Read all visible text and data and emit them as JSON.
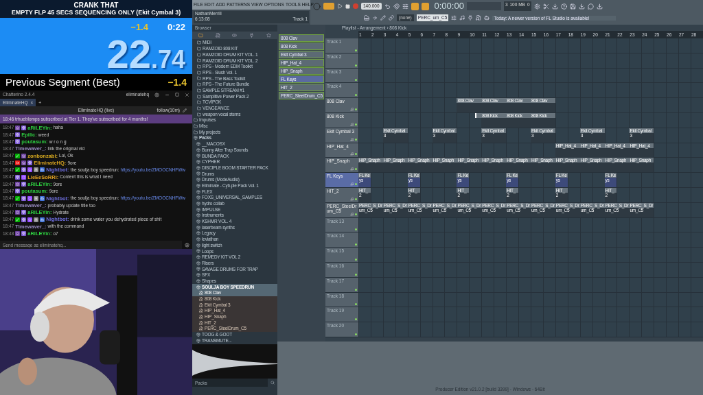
{
  "timer": {
    "game": "CRANK THAT",
    "category": "EMPTY FLP 45 SECS SEQUENCING ONLY (Ekit Cymbal 3)",
    "delta": "−1.4",
    "segment_time": "0:22",
    "main_whole": "22",
    "main_fraction": ".74",
    "previous_label": "Previous Segment (Best)",
    "previous_value": "−1.4"
  },
  "chat": {
    "app": "Chatterino 2.4.4",
    "account": "eliminatehq",
    "tab": "EliminateHQ",
    "tab_close": "×",
    "add_tab": "+",
    "channel": "EliminateHQ (live)",
    "follow": "follow(10m)",
    "notice": "18:46 trhueblomps subscribed at Tier 1. They've subscribed for 4 months!",
    "messages": [
      {
        "time": "18:47",
        "badges": [
          {
            "kind": "crown"
          },
          {
            "kind": "sub"
          }
        ],
        "user": "aRiLEYin:",
        "color": "#2ecc40",
        "text": "haha"
      },
      {
        "time": "18:47",
        "badges": [
          {
            "kind": "sub"
          }
        ],
        "user": "Epilic:",
        "color": "#2ecc40",
        "text": "weed"
      },
      {
        "time": "18:47",
        "badges": [
          {
            "kind": "sub"
          }
        ],
        "user": "poutasum:",
        "color": "#2ecc40",
        "text": "w r o n g"
      },
      {
        "time": "18:47",
        "user": "Timewaver_:",
        "color": "#9b8ec4",
        "text": "link the original vid"
      },
      {
        "time": "18:47",
        "badges": [
          {
            "kind": "mod"
          },
          {
            "kind": "crown"
          }
        ],
        "user": "zonbonzabi:",
        "color": "#e0b020",
        "text": "Lol, Ok"
      },
      {
        "time": "18:47",
        "badges": [
          {
            "kind": "broadcaster"
          },
          {
            "kind": "crown"
          },
          {
            "kind": "sub"
          }
        ],
        "user": "EliminateHQ:",
        "color": "#d4a020",
        "text": "9ore"
      },
      {
        "time": "18:47",
        "badges": [
          {
            "kind": "mod"
          },
          {
            "kind": "sub"
          },
          {
            "kind": "star"
          },
          {
            "kind": "gear"
          },
          {
            "kind": "bot"
          }
        ],
        "user": "Nightbot:",
        "color": "#6f6fe0",
        "text": "the soulja boy speedrun:",
        "link": "https://youtu.be/ZMOOCNHFWw"
      },
      {
        "time": "18:47",
        "badges": [
          {
            "kind": "sub"
          },
          {
            "kind": "star"
          }
        ],
        "user": "LieEeSoRRi:",
        "color": "#e0a020",
        "text": "Content this is what I need"
      },
      {
        "time": "18:47",
        "badges": [
          {
            "kind": "crown"
          },
          {
            "kind": "sub"
          }
        ],
        "user": "aRiLEYin:",
        "color": "#2ecc40",
        "text": "9ore"
      },
      {
        "time": "18:47",
        "badges": [
          {
            "kind": "sub"
          }
        ],
        "user": "poutasum:",
        "color": "#2ecc40",
        "text": "9ore"
      },
      {
        "time": "18:47",
        "badges": [
          {
            "kind": "mod"
          },
          {
            "kind": "sub"
          },
          {
            "kind": "star"
          },
          {
            "kind": "gear"
          },
          {
            "kind": "bot"
          }
        ],
        "user": "Nightbot:",
        "color": "#6f6fe0",
        "text": "the soulja boy speedrun:",
        "link": "https://youtu.be/ZMOOCNHFWw"
      },
      {
        "time": "18:47",
        "user": "Timewaver_:",
        "color": "#9b8ec4",
        "text": "probably update title too"
      },
      {
        "time": "18:47",
        "badges": [
          {
            "kind": "crown"
          },
          {
            "kind": "sub"
          }
        ],
        "user": "aRiLEYin:",
        "color": "#2ecc40",
        "text": "Hydrate"
      },
      {
        "time": "18:47",
        "badges": [
          {
            "kind": "mod"
          },
          {
            "kind": "sub"
          },
          {
            "kind": "star"
          },
          {
            "kind": "gear"
          },
          {
            "kind": "bot"
          }
        ],
        "user": "Nightbot:",
        "color": "#6f6fe0",
        "text": "drink some water you dehydrated piece of shit"
      },
      {
        "time": "18:47",
        "user": "Timewaver_:",
        "color": "#9b8ec4",
        "text": "with the command"
      },
      {
        "time": "18:48",
        "badges": [
          {
            "kind": "crown"
          },
          {
            "kind": "sub"
          }
        ],
        "user": "aRiLEYin:",
        "color": "#2ecc40",
        "text": "o7"
      }
    ],
    "input_placeholder": "Send message as eliminatehq..."
  },
  "menu": [
    "FILE",
    "EDIT",
    "ADD",
    "PATTERNS",
    "VIEW",
    "OPTIONS",
    "TOOLS",
    "HELP"
  ],
  "hint": {
    "user": "NathanMerrill",
    "time": "6:13:08",
    "track": "Track 1"
  },
  "transport": {
    "song_mode": true,
    "tempo": "140.000",
    "time": "0:00:00",
    "cpu": "3",
    "memory": "100 MB",
    "polyphony": "0",
    "mixer": "(none)",
    "pattern": "PERC_um_C5",
    "news": "Today: A newer version of FL Studio is available!"
  },
  "browser": {
    "title": "Browser",
    "search_placeholder": "Packs",
    "items": [
      {
        "kind": "subfolder",
        "label": "MIDI",
        "selected": false
      },
      {
        "kind": "subfolder",
        "label": "RAMZOID 808 KIT",
        "selected": false
      },
      {
        "kind": "subfolder",
        "label": "RAMZOID DRUM KIT VOL. 1",
        "selected": false
      },
      {
        "kind": "subfolder",
        "label": "RAMZOID DRUM KIT VOL. 2",
        "selected": false
      },
      {
        "kind": "subfolder",
        "label": "RPS - Modern EDM Toolkit",
        "selected": false
      },
      {
        "kind": "subfolder",
        "label": "RPS - Slush Vol. 1",
        "selected": false
      },
      {
        "kind": "subfolder",
        "label": "RPS - The Bass Toolkit",
        "selected": false
      },
      {
        "kind": "subfolder",
        "label": "RPS - The Future Bundle",
        "selected": false
      },
      {
        "kind": "subfolder",
        "label": "SAMPLE STREAM #1",
        "selected": false
      },
      {
        "kind": "subfolder",
        "label": "Samplitive Power Pack 2",
        "selected": false
      },
      {
        "kind": "subfolder",
        "label": "TCVIPOK",
        "selected": false
      },
      {
        "kind": "subfolder",
        "label": "VENGEANCE",
        "selected": false
      },
      {
        "kind": "subfolder",
        "label": "weapon vocal stems",
        "selected": false
      },
      {
        "kind": "folder",
        "label": "Impulses",
        "selected": false
      },
      {
        "kind": "folder",
        "label": "Misc",
        "selected": false
      },
      {
        "kind": "folder",
        "label": "My projects",
        "selected": false
      },
      {
        "kind": "header",
        "label": "Packs",
        "selected": false,
        "expanded": true,
        "children": [
          {
            "kind": "pack",
            "label": "__MACOSX",
            "selected": false
          },
          {
            "kind": "pack",
            "label": "Bunny Alter Trap Sounds",
            "selected": false
          },
          {
            "kind": "pack",
            "label": "BUNDA PACK",
            "selected": false
          },
          {
            "kind": "pack",
            "label": "CYPHER",
            "selected": false
          },
          {
            "kind": "pack",
            "label": "DISCIPLE BOOM STARTER PACK",
            "selected": false
          },
          {
            "kind": "pack",
            "label": "Drums",
            "selected": false
          },
          {
            "kind": "pack",
            "label": "Drums (ModeAudio)",
            "selected": false
          },
          {
            "kind": "pack",
            "label": "Eliminate - Cyb.ple Pack Vol. 1",
            "selected": false
          },
          {
            "kind": "pack",
            "label": "FLEX",
            "selected": false
          },
          {
            "kind": "pack",
            "label": "FOXS_UNIVERSAL_SAMPLES",
            "selected": false
          },
          {
            "kind": "pack",
            "label": "hydro collab",
            "selected": false
          },
          {
            "kind": "pack",
            "label": "IMPULSE",
            "selected": false
          },
          {
            "kind": "pack",
            "label": "Instruments",
            "selected": false
          },
          {
            "kind": "pack",
            "label": "KSHMR VOL. 4",
            "selected": false
          },
          {
            "kind": "pack",
            "label": "laserbeam synths",
            "selected": false
          },
          {
            "kind": "pack",
            "label": "Legacy",
            "selected": false
          },
          {
            "kind": "pack",
            "label": "leviathan",
            "selected": false
          },
          {
            "kind": "pack",
            "label": "light switch",
            "selected": false
          },
          {
            "kind": "pack",
            "label": "Loops",
            "selected": false
          },
          {
            "kind": "pack",
            "label": "REMEDY KIT VOL 2",
            "selected": false
          },
          {
            "kind": "pack",
            "label": "Risers",
            "selected": false
          },
          {
            "kind": "pack",
            "label": "SAVAGE DRUMS FOR TRAP",
            "selected": false
          },
          {
            "kind": "pack",
            "label": "SFX",
            "selected": false
          },
          {
            "kind": "pack",
            "label": "Shapes",
            "selected": false
          },
          {
            "kind": "pack",
            "label": "SOULJA BOY SPEEDRUN",
            "selected": true,
            "expanded": true,
            "children": [
              {
                "kind": "sample",
                "label": "808 Clav",
                "selected": true
              },
              {
                "kind": "sample",
                "label": "808 Kick",
                "selected": false
              },
              {
                "kind": "sample",
                "label": "Ekit Cymbal 3",
                "selected": false
              },
              {
                "kind": "sample",
                "label": "HIP_Hat_4",
                "selected": false
              },
              {
                "kind": "sample",
                "label": "HIP_Snaph",
                "selected": false
              },
              {
                "kind": "sample",
                "label": "HIT_2",
                "selected": false
              },
              {
                "kind": "sample",
                "label": "PERC_SteelDrum_C5",
                "selected": false
              }
            ]
          },
          {
            "kind": "pack",
            "label": "TOOG & GOOT",
            "selected": false
          },
          {
            "kind": "pack",
            "label": "TRANSMUTE...",
            "selected": false
          }
        ]
      }
    ]
  },
  "channel_rack": {
    "channels": [
      {
        "name": "808 Clav",
        "selected": false
      },
      {
        "name": "808 Kick",
        "selected": false
      },
      {
        "name": "Ekit Cymbal 3",
        "selected": false
      },
      {
        "name": "HIP_Hat_4",
        "selected": false
      },
      {
        "name": "HIP_Snaph",
        "selected": false
      },
      {
        "name": "FL Keys",
        "selected": true
      },
      {
        "name": "HIT_2",
        "selected": false
      },
      {
        "name": "PERC_SteelDrum_C5",
        "selected": false
      }
    ]
  },
  "playlist": {
    "title": "Playlist - Arrangement › 808 Kick",
    "ruler": [
      "1",
      "2",
      "3",
      "4",
      "5",
      "6",
      "7",
      "8",
      "9",
      "10",
      "11",
      "12",
      "13",
      "14",
      "15",
      "16",
      "17",
      "18",
      "19",
      "20",
      "21",
      "22",
      "23",
      "24",
      "25",
      "26",
      "27",
      "28"
    ],
    "tracks": [
      {
        "kind": "empty",
        "name": "Track 1",
        "selected": false
      },
      {
        "kind": "empty",
        "name": "Track 2",
        "selected": false
      },
      {
        "kind": "empty",
        "name": "Track 3",
        "selected": false
      },
      {
        "kind": "empty",
        "name": "Track 4",
        "selected": false
      },
      {
        "kind": "pattern",
        "name": "808 Clav",
        "selected": false,
        "clips": [
          {
            "label": "808 Clav"
          },
          {
            "label": "808 Clav"
          },
          {
            "label": "808 Clav"
          },
          {
            "label": "808 Clav"
          }
        ]
      },
      {
        "kind": "pattern",
        "name": "808 Kick",
        "selected": false,
        "clips": [
          {
            "kind": "stub"
          },
          {
            "kind": "pattern",
            "label": "808 Kick"
          },
          {
            "kind": "pattern",
            "label": "808 Kick"
          },
          {
            "kind": "pattern",
            "label": "808 Kick"
          }
        ]
      },
      {
        "kind": "pattern",
        "name": "Ekit Cymbal 3",
        "selected": false,
        "clips": [
          {
            "label": "Ekit Cymbal 3"
          },
          {
            "label": "Ekit Cymbal 3"
          },
          {
            "label": "Ekit Cymbal 3"
          },
          {
            "label": "Ekit Cymbal 3"
          },
          {
            "label": "Ekit Cymbal 3"
          },
          {
            "label": "Ekit Cymbal 3"
          }
        ]
      },
      {
        "kind": "pattern",
        "name": "HIP_Hat_4",
        "selected": false,
        "clips": [
          {
            "label": "HIP_Hat_4"
          },
          {
            "label": "HIP_Hat_4"
          },
          {
            "label": "HIP_Hat_4"
          },
          {
            "label": "HIP_Hat_4"
          }
        ]
      },
      {
        "kind": "pattern",
        "name": "HIP_Snaph",
        "selected": false,
        "clips": [
          {
            "label": "HIP_Snaph"
          },
          {
            "label": "HIP_Snaph"
          },
          {
            "label": "HIP_Snaph"
          },
          {
            "label": "HIP_Snaph"
          },
          {
            "label": "HIP_Snaph"
          },
          {
            "label": "HIP_Snaph"
          },
          {
            "label": "HIP_Snaph"
          },
          {
            "label": "HIP_Snaph"
          },
          {
            "label": "HIP_Snaph"
          },
          {
            "label": "HIP_Snaph"
          },
          {
            "label": "HIP_Snaph"
          },
          {
            "label": "HIP_Snaph"
          }
        ]
      },
      {
        "kind": "pattern",
        "name": "FL Keys",
        "selected": true,
        "clips": [
          {
            "label": "FL Keys"
          },
          {
            "label": "FL Keys"
          },
          {
            "label": "FL Keys"
          },
          {
            "label": "FL Keys"
          },
          {
            "label": "FL Keys"
          },
          {
            "label": "FL Keys"
          }
        ]
      },
      {
        "kind": "pattern",
        "name": "HIT_2",
        "selected": false,
        "clips": [
          {
            "label": "HIT_2"
          },
          {
            "label": "HIT_2"
          },
          {
            "label": "HIT_2"
          },
          {
            "label": "HIT_2"
          },
          {
            "label": "HIT_2"
          },
          {
            "label": "HIT_2"
          }
        ]
      },
      {
        "kind": "pattern",
        "name": "PERC_SteelDrum_C5",
        "selected": false,
        "clips": [
          {
            "label": "PERC_S_Drum_C5"
          },
          {
            "label": "PERC_S_Drum_C5"
          },
          {
            "label": "PERC_S_Drum_C5"
          },
          {
            "label": "PERC_S_Drum_C5"
          },
          {
            "label": "PERC_S_Drum_C5"
          },
          {
            "label": "PERC_S_Drum_C5"
          },
          {
            "label": "PERC_S_Drum_C5"
          },
          {
            "label": "PERC_S_Drum_C5"
          },
          {
            "label": "PERC_S_Drum_C5"
          },
          {
            "label": "PERC_S_Drum_C5"
          },
          {
            "label": "PERC_S_Drum_C5"
          },
          {
            "label": "PERC_S_Drum_C5"
          }
        ]
      },
      {
        "kind": "empty",
        "name": "Track 13",
        "selected": false
      },
      {
        "kind": "empty",
        "name": "Track 14",
        "selected": false
      },
      {
        "kind": "empty",
        "name": "Track 15",
        "selected": false
      },
      {
        "kind": "empty",
        "name": "Track 16",
        "selected": false
      },
      {
        "kind": "empty",
        "name": "Track 17",
        "selected": false
      },
      {
        "kind": "empty",
        "name": "Track 18",
        "selected": false
      },
      {
        "kind": "empty",
        "name": "Track 19",
        "selected": false
      },
      {
        "kind": "empty",
        "name": "Track 20",
        "selected": false
      }
    ]
  },
  "status": "Producer Edition v21.0.2 [build 3399] - Windows - 64Bit"
}
